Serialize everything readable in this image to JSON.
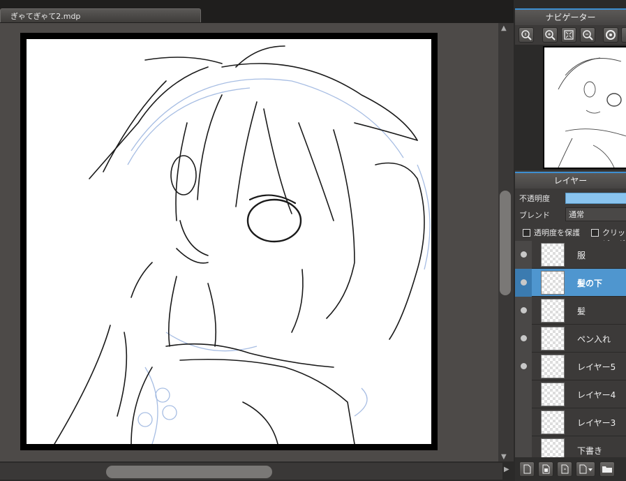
{
  "document": {
    "tab_title": "ぎゃてぎゃて2.mdp"
  },
  "navigator": {
    "title": "ナビゲーター",
    "tools": [
      "zoom-actual-icon",
      "zoom-in-icon",
      "fit-window-icon",
      "zoom-out-icon",
      "rotate-icon",
      "more-icon"
    ]
  },
  "layer_panel": {
    "title": "レイヤー",
    "opacity_label": "不透明度",
    "opacity_value": 1.0,
    "blend_label": "ブレンド",
    "blend_value": "通常",
    "protect_alpha_label": "透明度を保護",
    "clipping_label": "クリッピング",
    "layers": [
      {
        "name": "服",
        "visible": true,
        "selected": false
      },
      {
        "name": "髪の下",
        "visible": true,
        "selected": true
      },
      {
        "name": "髪",
        "visible": true,
        "selected": false
      },
      {
        "name": "ペン入れ",
        "visible": true,
        "selected": false
      },
      {
        "name": "レイヤー5",
        "visible": true,
        "selected": false
      },
      {
        "name": "レイヤー4",
        "visible": false,
        "selected": false
      },
      {
        "name": "レイヤー3",
        "visible": false,
        "selected": false
      },
      {
        "name": "下書き",
        "visible": false,
        "selected": false
      }
    ],
    "bottom_tools": [
      "new-layer-icon",
      "new-raster-layer-icon",
      "duplicate-layer-icon",
      "add-layer-menu-icon",
      "folder-icon"
    ]
  },
  "colors": {
    "accent": "#3d8fd1",
    "selected_layer": "#4f96cf",
    "canvas_bg": "#4d4a48"
  }
}
